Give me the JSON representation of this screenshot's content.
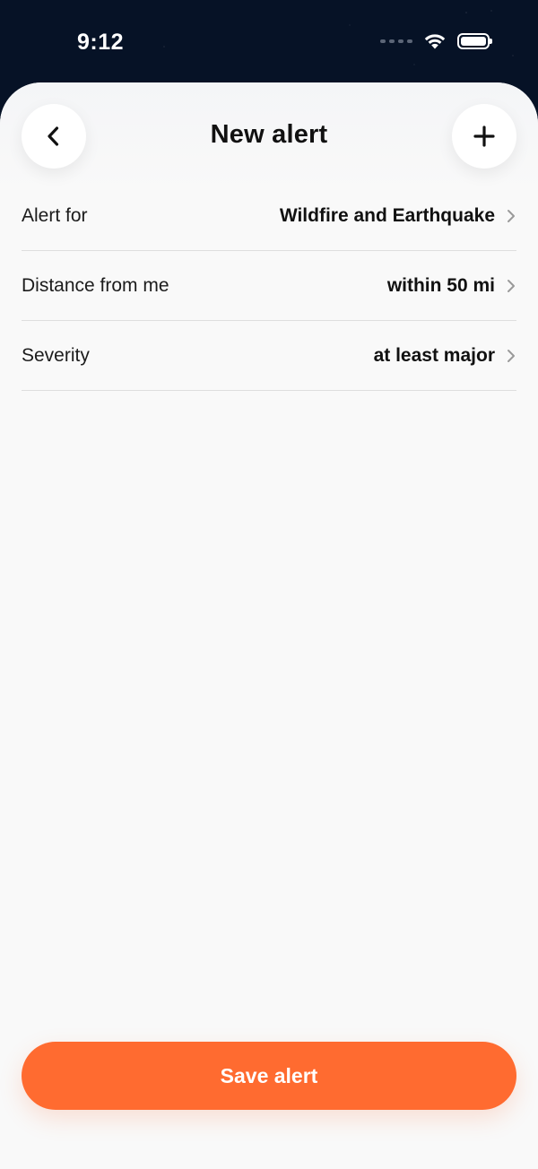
{
  "status_bar": {
    "time": "9:12",
    "icons": [
      "signal-dots-icon",
      "wifi-icon",
      "battery-icon"
    ]
  },
  "header": {
    "title": "New alert",
    "back_icon": "chevron-left-icon",
    "add_icon": "plus-icon"
  },
  "settings": [
    {
      "label": "Alert for",
      "value": "Wildfire and Earthquake"
    },
    {
      "label": "Distance from me",
      "value": "within 50 mi"
    },
    {
      "label": "Severity",
      "value": "at least major"
    }
  ],
  "footer": {
    "save_label": "Save alert"
  },
  "colors": {
    "accent": "#ff6b30",
    "background_top": "#061226",
    "sheet": "#f9f9f9",
    "divider": "#dedede"
  }
}
